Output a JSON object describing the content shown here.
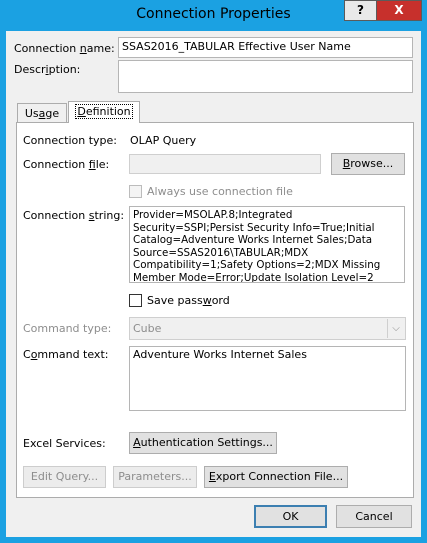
{
  "window": {
    "title": "Connection Properties",
    "help_glyph": "?",
    "close_glyph": "X"
  },
  "connection_name": {
    "label_pre": "Connection ",
    "label_key": "n",
    "label_post": "ame:",
    "value": "SSAS2016_TABULAR Effective User Name"
  },
  "description": {
    "label_pre": "Descr",
    "label_key": "i",
    "label_post": "ption:",
    "value": ""
  },
  "tabs": {
    "usage_pre": "Us",
    "usage_key": "a",
    "usage_post": "ge",
    "definition_pre": "",
    "definition_key": "D",
    "definition_post": "efinition"
  },
  "definition": {
    "connection_type_label": "Connection type:",
    "connection_type_value": "OLAP Query",
    "connection_file_label_pre": "Connection ",
    "connection_file_label_key": "f",
    "connection_file_label_post": "ile:",
    "connection_file_value": "",
    "browse_pre": "",
    "browse_key": "B",
    "browse_post": "rowse...",
    "always_use_label": "Always use connection file",
    "connection_string_label_pre": "Connection ",
    "connection_string_label_key": "s",
    "connection_string_label_post": "tring:",
    "connection_string_value": "Provider=MSOLAP.8;Integrated Security=SSPI;Persist Security Info=True;Initial Catalog=Adventure Works Internet Sales;Data Source=SSAS2016\\TABULAR;MDX Compatibility=1;Safety Options=2;MDX Missing Member Mode=Error;Update Isolation Level=2",
    "save_password_pre": "Save pass",
    "save_password_key": "w",
    "save_password_post": "ord",
    "command_type_label": "Command type:",
    "command_type_value": "Cube",
    "command_text_label_pre": "C",
    "command_text_label_key": "o",
    "command_text_label_post": "mmand text:",
    "command_text_value": "Adventure Works Internet Sales",
    "excel_services_label": "Excel Services:",
    "auth_settings_pre": "",
    "auth_settings_key": "A",
    "auth_settings_post": "uthentication Settings...",
    "edit_query_label": "Edit Query...",
    "parameters_label": "Parameters...",
    "export_pre": "",
    "export_key": "E",
    "export_post": "xport Connection File..."
  },
  "footer": {
    "ok_label": "OK",
    "cancel_label": "Cancel"
  },
  "icons": {
    "dropdown_arrow": "chevron-down-icon"
  }
}
